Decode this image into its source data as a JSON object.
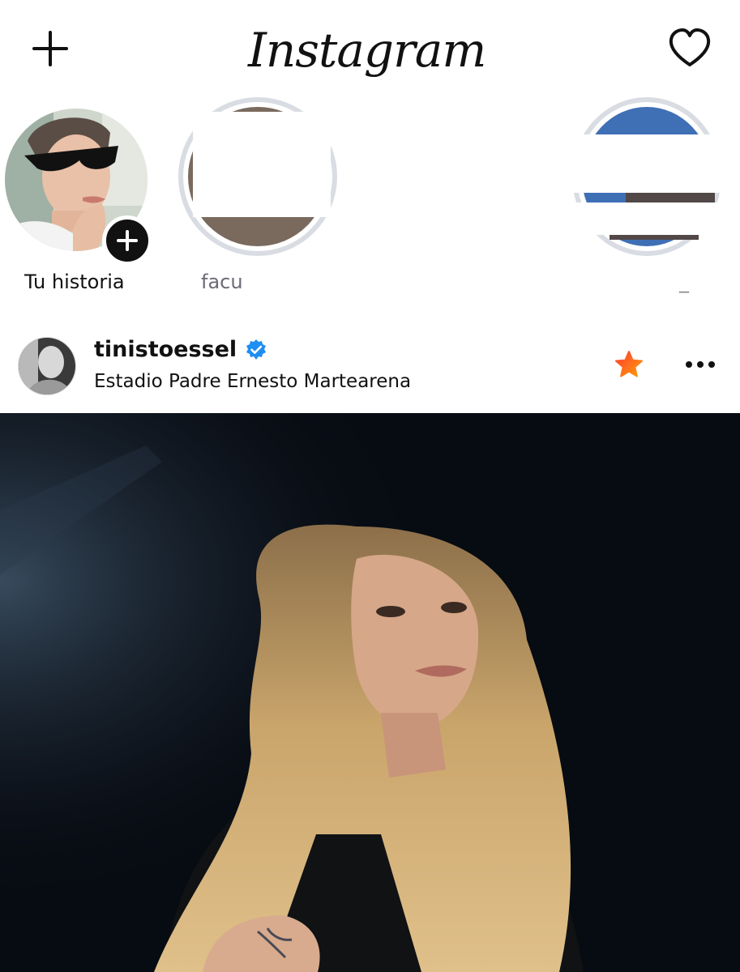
{
  "app": {
    "logo_text": "Instagram"
  },
  "header": {
    "new_post_icon": "plus-icon",
    "activity_icon": "heart-outline-icon"
  },
  "stories": {
    "items": [
      {
        "label": "Tu historia",
        "is_own": true,
        "badge_icon": "add-story-plus-icon"
      },
      {
        "label": "facu",
        "is_own": false
      },
      {
        "label": "_",
        "is_own": false
      }
    ]
  },
  "post": {
    "username": "tinistoessel",
    "verified": true,
    "location": "Estadio Padre Ernesto Martearena",
    "favorite_icon": "star-icon",
    "more_icon": "more-horizontal-icon"
  },
  "colors": {
    "verified_blue": "#1f8ef1",
    "star_gradient_start": "#ff3b30",
    "star_gradient_end": "#ff9f0a",
    "story_ring_seen": "#d9dde3",
    "photo_background": "#070b12"
  }
}
